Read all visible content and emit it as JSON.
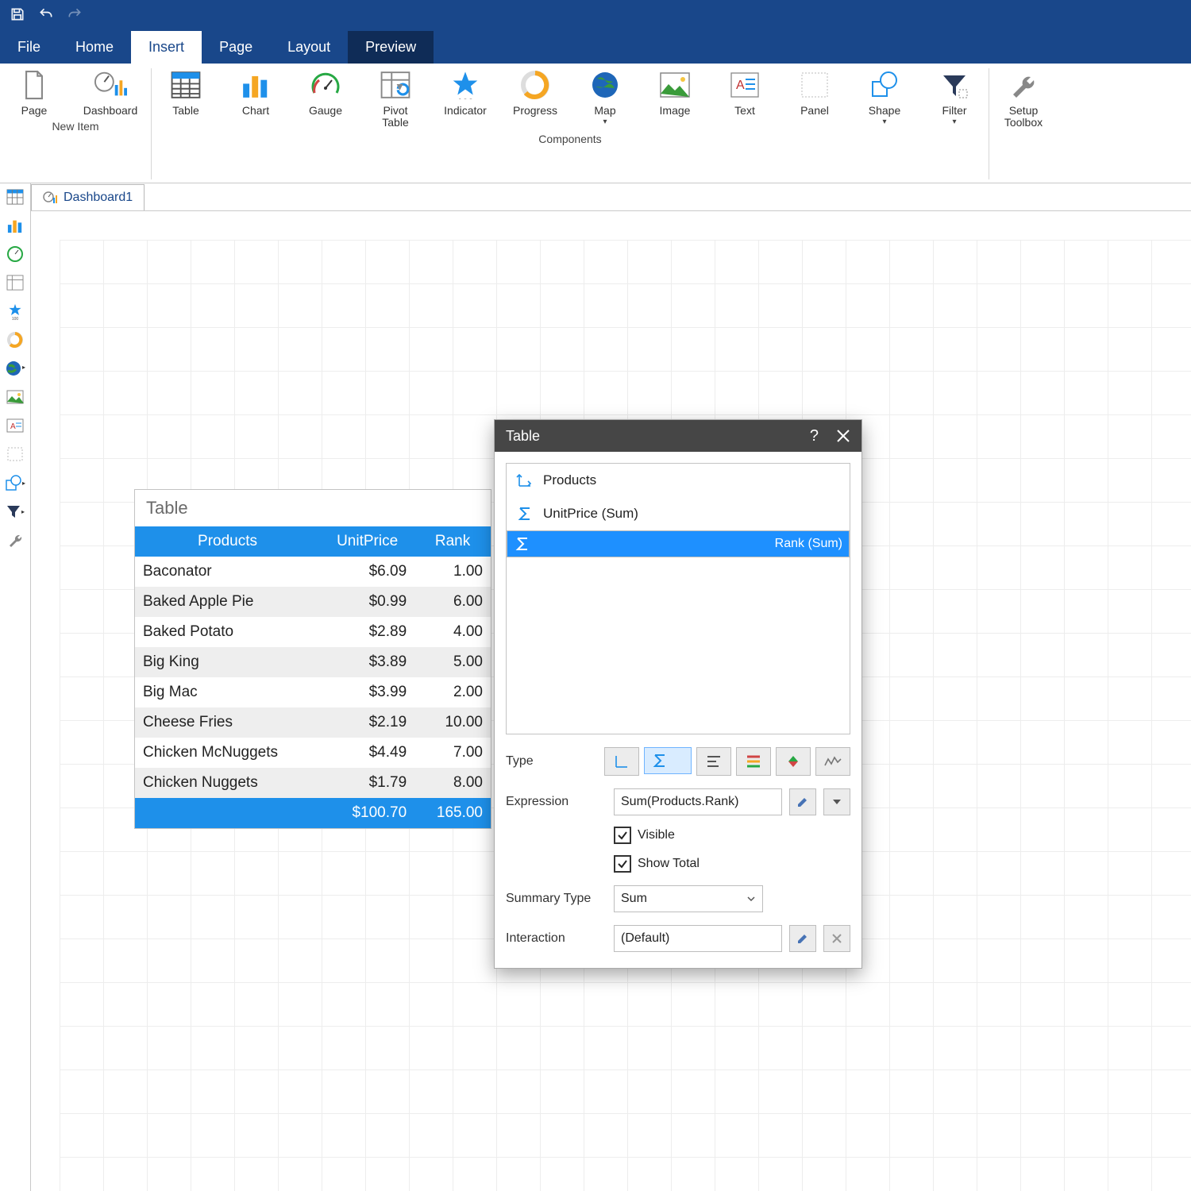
{
  "titlebar": {
    "save": "",
    "undo": "",
    "redo": ""
  },
  "menu": {
    "file": "File",
    "home": "Home",
    "insert": "Insert",
    "page": "Page",
    "layout": "Layout",
    "preview": "Preview"
  },
  "ribbon": {
    "group1_caption": "New Item",
    "group2_caption": "Components",
    "items": {
      "page": "Page",
      "dashboard": "Dashboard",
      "table": "Table",
      "chart": "Chart",
      "gauge": "Gauge",
      "pivot": "Pivot\nTable",
      "indicator": "Indicator",
      "progress": "Progress",
      "map": "Map",
      "image": "Image",
      "text": "Text",
      "panel": "Panel",
      "shape": "Shape",
      "filter": "Filter",
      "setup": "Setup\nToolbox"
    }
  },
  "tab": {
    "name": "Dashboard1"
  },
  "table": {
    "title": "Table",
    "headers": {
      "c0": "Products",
      "c1": "UnitPrice",
      "c2": "Rank"
    },
    "rows": [
      {
        "c0": "Baconator",
        "c1": "$6.09",
        "c2": "1.00"
      },
      {
        "c0": "Baked Apple Pie",
        "c1": "$0.99",
        "c2": "6.00"
      },
      {
        "c0": "Baked Potato",
        "c1": "$2.89",
        "c2": "4.00"
      },
      {
        "c0": "Big King",
        "c1": "$3.89",
        "c2": "5.00"
      },
      {
        "c0": "Big Mac",
        "c1": "$3.99",
        "c2": "2.00"
      },
      {
        "c0": "Cheese Fries",
        "c1": "$2.19",
        "c2": "10.00"
      },
      {
        "c0": "Chicken McNuggets",
        "c1": "$4.49",
        "c2": "7.00"
      },
      {
        "c0": "Chicken Nuggets",
        "c1": "$1.79",
        "c2": "8.00"
      }
    ],
    "total": {
      "c1": "$100.70",
      "c2": "165.00"
    }
  },
  "dialog": {
    "title": "Table",
    "list": {
      "i0": "Products",
      "i1": "UnitPrice (Sum)",
      "i2": "Rank (Sum)"
    },
    "labels": {
      "type": "Type",
      "expression": "Expression",
      "visible": "Visible",
      "showtotal": "Show Total",
      "summary": "Summary Type",
      "interaction": "Interaction"
    },
    "expression": "Sum(Products.Rank)",
    "summary_value": "Sum",
    "interaction_value": "(Default)"
  },
  "chart_data": {
    "type": "table",
    "title": "Table",
    "columns": [
      "Products",
      "UnitPrice",
      "Rank"
    ],
    "rows": [
      [
        "Baconator",
        6.09,
        1.0
      ],
      [
        "Baked Apple Pie",
        0.99,
        6.0
      ],
      [
        "Baked Potato",
        2.89,
        4.0
      ],
      [
        "Big King",
        3.89,
        5.0
      ],
      [
        "Big Mac",
        3.99,
        2.0
      ],
      [
        "Cheese Fries",
        2.19,
        10.0
      ],
      [
        "Chicken McNuggets",
        4.49,
        7.0
      ],
      [
        "Chicken Nuggets",
        1.79,
        8.0
      ]
    ],
    "totals": {
      "UnitPrice": 100.7,
      "Rank": 165.0
    }
  }
}
